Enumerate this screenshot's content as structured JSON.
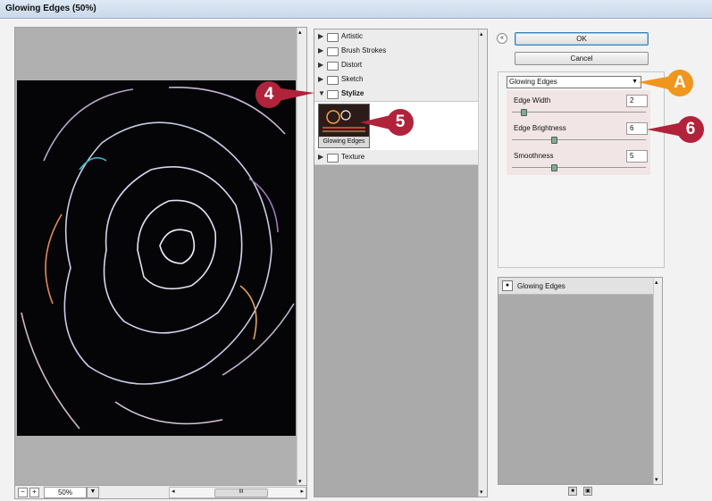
{
  "window": {
    "title": "Glowing Edges (50%)"
  },
  "preview": {
    "zoom_value": "50%",
    "zoom_minus": "−",
    "zoom_plus": "+",
    "dropdown_arrow": "▼",
    "scroll_left": "◂",
    "scroll_right": "▸",
    "scroll_up": "▴",
    "scroll_down": "▾",
    "thumb_grip": "III"
  },
  "filter_tree": {
    "categories": [
      {
        "label": "Artistic",
        "expanded": false
      },
      {
        "label": "Brush Strokes",
        "expanded": false
      },
      {
        "label": "Distort",
        "expanded": false
      },
      {
        "label": "Sketch",
        "expanded": false
      },
      {
        "label": "Stylize",
        "expanded": true
      },
      {
        "label": "Texture",
        "expanded": false
      }
    ],
    "collapsed_marker": "▶",
    "expanded_marker": "▼",
    "selected_filter": "Glowing Edges"
  },
  "buttons": {
    "ok": "OK",
    "cancel": "Cancel",
    "collapse": "«"
  },
  "filter_select": {
    "value": "Glowing Edges",
    "arrow": "▼"
  },
  "params": [
    {
      "label": "Edge Width",
      "value": "2",
      "level": 0.18
    },
    {
      "label": "Edge Brightness",
      "value": "6",
      "level": 0.3
    },
    {
      "label": "Smoothness",
      "value": "5",
      "level": 0.3
    }
  ],
  "layers": {
    "items": [
      {
        "label": "Glowing Edges"
      }
    ],
    "eye_glyph": "●",
    "new_glyph": "■",
    "delete_glyph": "▣"
  },
  "callouts": [
    {
      "label": "4",
      "color": "#b0233a"
    },
    {
      "label": "5",
      "color": "#b0233a"
    },
    {
      "label": "6",
      "color": "#b0233a"
    },
    {
      "label": "A",
      "color": "#f0961f"
    }
  ]
}
